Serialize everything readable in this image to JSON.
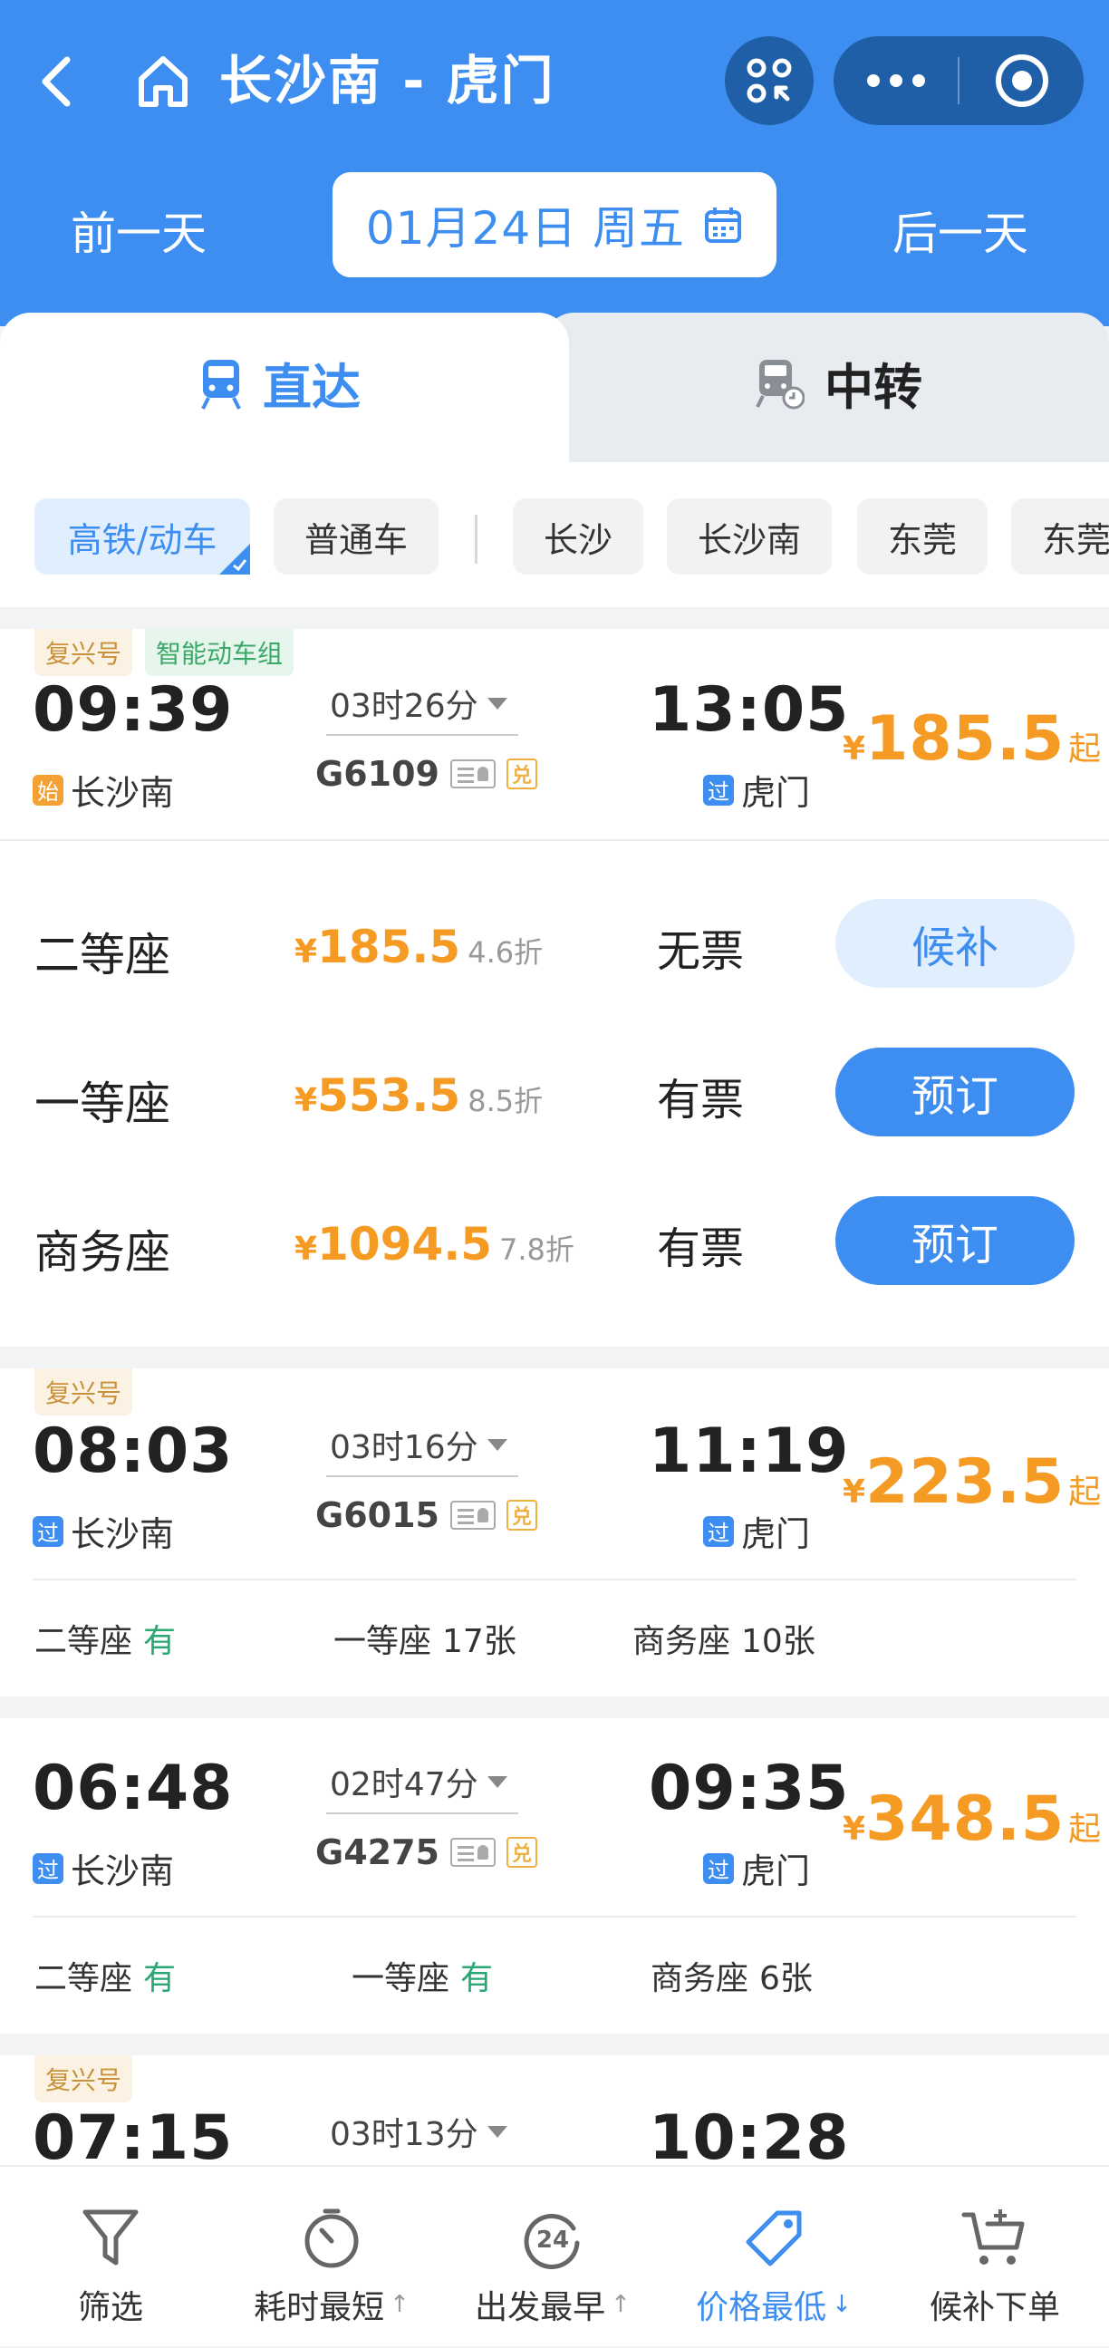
{
  "header": {
    "title": "长沙南 - 虎门",
    "prev_day": "前一天",
    "next_day": "后一天",
    "date": "01月24日 周五",
    "colors": {
      "primary": "#3d8ef0",
      "capsule": "#1f5fa8"
    }
  },
  "tabs": [
    {
      "label": "直达",
      "active": true
    },
    {
      "label": "中转",
      "active": false
    }
  ],
  "filters": [
    {
      "label": "高铁/动车",
      "active": true
    },
    {
      "label": "普通车",
      "active": false
    },
    {
      "label": "长沙",
      "active": false
    },
    {
      "label": "长沙南",
      "active": false
    },
    {
      "label": "东莞",
      "active": false
    },
    {
      "label": "东莞",
      "active": false
    }
  ],
  "trains": [
    {
      "tags": [
        "复兴号",
        "智能动车组"
      ],
      "dep_time": "09:39",
      "dep_badge": "始",
      "dep_station": "长沙南",
      "duration": "03时26分",
      "train_no": "G6109",
      "arr_time": "13:05",
      "arr_badge": "过",
      "arr_station": "虎门",
      "price_symbol": "¥",
      "price": "185.5",
      "price_suffix": "起",
      "seats": [
        {
          "name": "二等座",
          "price": "185.5",
          "discount": "4.6折",
          "status": "无票",
          "action": "候补"
        },
        {
          "name": "一等座",
          "price": "553.5",
          "discount": "8.5折",
          "status": "有票",
          "action": "预订"
        },
        {
          "name": "商务座",
          "price": "1094.5",
          "discount": "7.8折",
          "status": "有票",
          "action": "预订"
        }
      ]
    },
    {
      "tags": [
        "复兴号"
      ],
      "dep_time": "08:03",
      "dep_badge": "过",
      "dep_station": "长沙南",
      "duration": "03时16分",
      "train_no": "G6015",
      "arr_time": "11:19",
      "arr_badge": "过",
      "arr_station": "虎门",
      "price_symbol": "¥",
      "price": "223.5",
      "price_suffix": "起",
      "summary": [
        {
          "name": "二等座",
          "value": "有"
        },
        {
          "name": "一等座",
          "value": "17张"
        },
        {
          "name": "商务座",
          "value": "10张"
        }
      ]
    },
    {
      "tags": [],
      "dep_time": "06:48",
      "dep_badge": "过",
      "dep_station": "长沙南",
      "duration": "02时47分",
      "train_no": "G4275",
      "arr_time": "09:35",
      "arr_badge": "过",
      "arr_station": "虎门",
      "price_symbol": "¥",
      "price": "348.5",
      "price_suffix": "起",
      "summary": [
        {
          "name": "二等座",
          "value": "有"
        },
        {
          "name": "一等座",
          "value": "有"
        },
        {
          "name": "商务座",
          "value": "6张"
        }
      ]
    },
    {
      "tags": [
        "复兴号"
      ],
      "dep_time": "07:15",
      "duration": "03时13分",
      "arr_time": "10:28"
    }
  ],
  "bottom_bar": [
    {
      "label": "筛选",
      "icon": "filter-icon",
      "active": false
    },
    {
      "label": "耗时最短",
      "icon": "stopwatch-icon",
      "active": false
    },
    {
      "label": "出发最早",
      "icon": "clock-24-icon",
      "active": false
    },
    {
      "label": "价格最低",
      "icon": "price-tag-icon",
      "active": true
    },
    {
      "label": "候补下单",
      "icon": "cart-plus-icon",
      "active": false
    }
  ]
}
